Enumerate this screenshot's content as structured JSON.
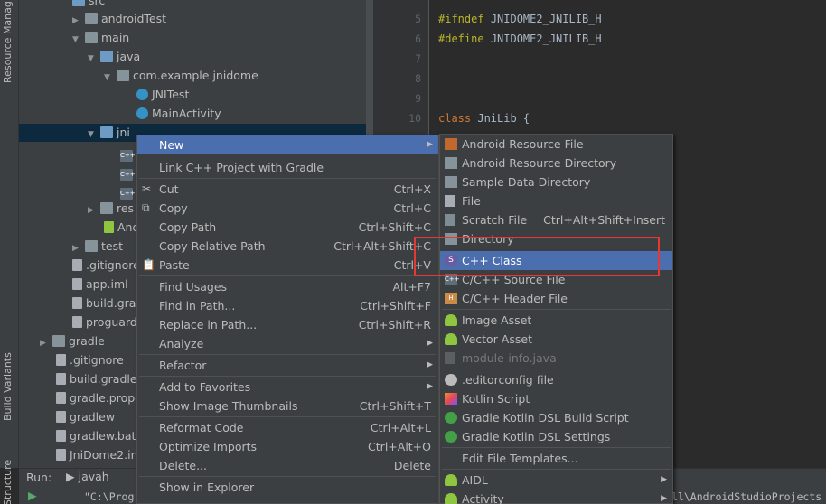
{
  "left_strip": {
    "resource_manager": "Resource Manag",
    "build_variants": "Build Variants",
    "structure": "Structure"
  },
  "tree": [
    {
      "label": "src",
      "indent": 0
    },
    {
      "label": "androidTest"
    },
    {
      "label": "main"
    },
    {
      "label": "java"
    },
    {
      "label": "com.example.jnidome"
    },
    {
      "label": "JNITest"
    },
    {
      "label": "MainActivity"
    },
    {
      "label": "jni"
    },
    {
      "label": ""
    },
    {
      "label": ""
    },
    {
      "label": ""
    },
    {
      "label": "res"
    },
    {
      "label": "And"
    },
    {
      "label": "test"
    },
    {
      "label": ".gitignore"
    },
    {
      "label": "app.iml"
    },
    {
      "label": "build.grad"
    },
    {
      "label": "proguard"
    },
    {
      "label": "gradle"
    },
    {
      "label": ".gitignore"
    },
    {
      "label": "build.gradle"
    },
    {
      "label": "gradle.prope"
    },
    {
      "label": "gradlew"
    },
    {
      "label": "gradlew.bat"
    },
    {
      "label": "JniDome2.im"
    }
  ],
  "editor": {
    "line_numbers": [
      "5",
      "6",
      "7",
      "8",
      "9",
      "10"
    ],
    "ifndef": "#ifndef",
    "ifndef_id": "JNIDOME2_JNILIB_H",
    "define": "#define",
    "define_id": "JNIDOME2_JNILIB_H",
    "class_kw": "class",
    "class_rest": "JniLib {"
  },
  "context_menu": {
    "items": [
      {
        "label": "New",
        "shortcut": "",
        "submenu": true
      },
      {
        "label": "Link C++ Project with Gradle",
        "shortcut": ""
      },
      {
        "label": "Cut",
        "shortcut": "Ctrl+X"
      },
      {
        "label": "Copy",
        "shortcut": "Ctrl+C"
      },
      {
        "label": "Copy Path",
        "shortcut": "Ctrl+Shift+C"
      },
      {
        "label": "Copy Relative Path",
        "shortcut": "Ctrl+Alt+Shift+C"
      },
      {
        "label": "Paste",
        "shortcut": "Ctrl+V"
      },
      {
        "label": "Find Usages",
        "shortcut": "Alt+F7"
      },
      {
        "label": "Find in Path...",
        "shortcut": "Ctrl+Shift+F"
      },
      {
        "label": "Replace in Path...",
        "shortcut": "Ctrl+Shift+R"
      },
      {
        "label": "Analyze",
        "shortcut": "",
        "submenu": true
      },
      {
        "label": "Refactor",
        "shortcut": "",
        "submenu": true
      },
      {
        "label": "Add to Favorites",
        "shortcut": "",
        "submenu": true
      },
      {
        "label": "Show Image Thumbnails",
        "shortcut": "Ctrl+Shift+T"
      },
      {
        "label": "Reformat Code",
        "shortcut": "Ctrl+Alt+L"
      },
      {
        "label": "Optimize Imports",
        "shortcut": "Ctrl+Alt+O"
      },
      {
        "label": "Delete...",
        "shortcut": "Delete"
      },
      {
        "label": "Show in Explorer",
        "shortcut": ""
      }
    ]
  },
  "new_submenu": {
    "items": [
      {
        "label": "Android Resource File",
        "shortcut": ""
      },
      {
        "label": "Android Resource Directory",
        "shortcut": ""
      },
      {
        "label": "Sample Data Directory",
        "shortcut": ""
      },
      {
        "label": "File",
        "shortcut": ""
      },
      {
        "label": "Scratch File",
        "shortcut": "Ctrl+Alt+Shift+Insert"
      },
      {
        "label": "Directory",
        "shortcut": ""
      },
      {
        "label": "C++ Class",
        "shortcut": ""
      },
      {
        "label": "C/C++ Source File",
        "shortcut": ""
      },
      {
        "label": "C/C++ Header File",
        "shortcut": ""
      },
      {
        "label": "Image Asset",
        "shortcut": ""
      },
      {
        "label": "Vector Asset",
        "shortcut": ""
      },
      {
        "label": "module-info.java",
        "shortcut": ""
      },
      {
        "label": ".editorconfig file",
        "shortcut": ""
      },
      {
        "label": "Kotlin Script",
        "shortcut": ""
      },
      {
        "label": "Gradle Kotlin DSL Build Script",
        "shortcut": ""
      },
      {
        "label": "Gradle Kotlin DSL Settings",
        "shortcut": ""
      },
      {
        "label": "Edit File Templates...",
        "shortcut": ""
      },
      {
        "label": "AIDL",
        "shortcut": ""
      },
      {
        "label": "Activity",
        "shortcut": ""
      }
    ]
  },
  "run_bar": {
    "run_label": "Run:",
    "config": "javah",
    "console_left": "\"C:\\Prog",
    "console_right": "ll\\AndroidStudioProjects"
  },
  "colors": {
    "highlight": "#4b6eaf",
    "annotation_box": "#e53935",
    "panel": "#3c3f41"
  }
}
